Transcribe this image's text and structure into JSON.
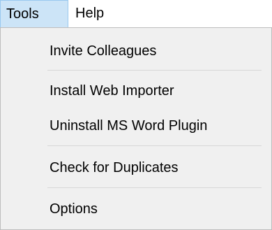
{
  "menubar": {
    "items": [
      {
        "label": "Tools",
        "active": true
      },
      {
        "label": "Help",
        "active": false
      }
    ]
  },
  "tools_menu": {
    "items": [
      {
        "label": "Invite Colleagues"
      },
      {
        "label": "Install Web Importer"
      },
      {
        "label": "Uninstall MS Word Plugin"
      },
      {
        "label": "Check for Duplicates"
      },
      {
        "label": "Options"
      }
    ]
  },
  "colors": {
    "active_menu_bg": "#cce4f7",
    "active_menu_border": "#99c9ef",
    "dropdown_bg": "#f0f0f0",
    "separator": "#d7d7d7"
  }
}
